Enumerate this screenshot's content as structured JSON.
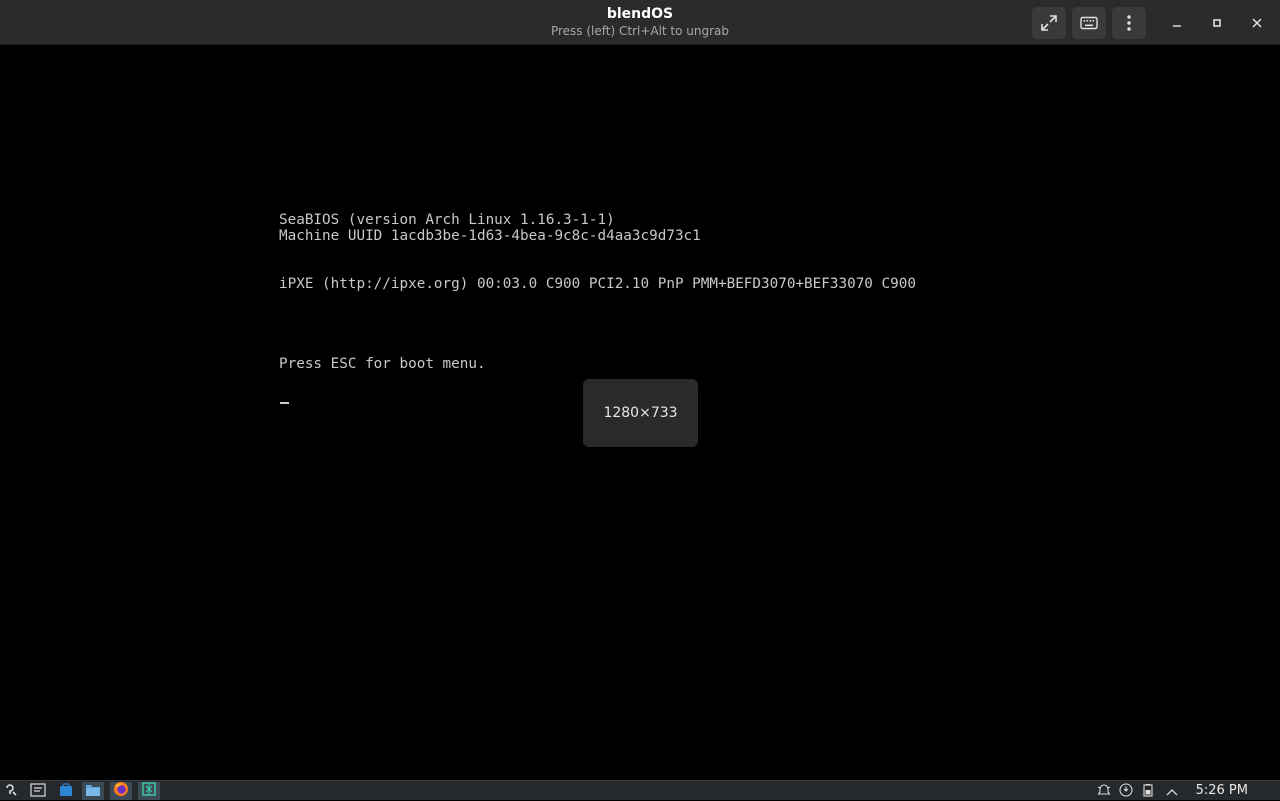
{
  "window": {
    "title": "blendOS",
    "subtitle": "Press (left) Ctrl+Alt to ungrab",
    "buttons": [
      "fullscreen-icon",
      "keyboard-icon",
      "menu-icon",
      "minimize-icon",
      "maximize-icon",
      "close-icon"
    ]
  },
  "bios": {
    "line1": "SeaBIOS (version Arch Linux 1.16.3-1-1)",
    "line2": "Machine UUID 1acdb3be-1d63-4bea-9c8c-d4aa3c9d73c1",
    "line3": "iPXE (http://ipxe.org) 00:03.0 C900 PCI2.10 PnP PMM+BEFD3070+BEF33070 C900",
    "line4": "Press ESC for boot menu."
  },
  "osd": {
    "resolution": "1280×733"
  },
  "taskbar": {
    "launchers": [
      "app-launcher-icon",
      "task-switcher-icon",
      "store-icon",
      "files-icon",
      "firefox-icon",
      "vm-app-icon"
    ],
    "tray": [
      "alert-icon",
      "clipboard-icon",
      "battery-icon",
      "tray-expand-icon"
    ],
    "clock": "5:26 PM"
  },
  "colors": {
    "titlebar": "#2b2b2b",
    "screen": "#000000",
    "bios_text": "#c8c8c8",
    "taskbar": "#26292c"
  }
}
